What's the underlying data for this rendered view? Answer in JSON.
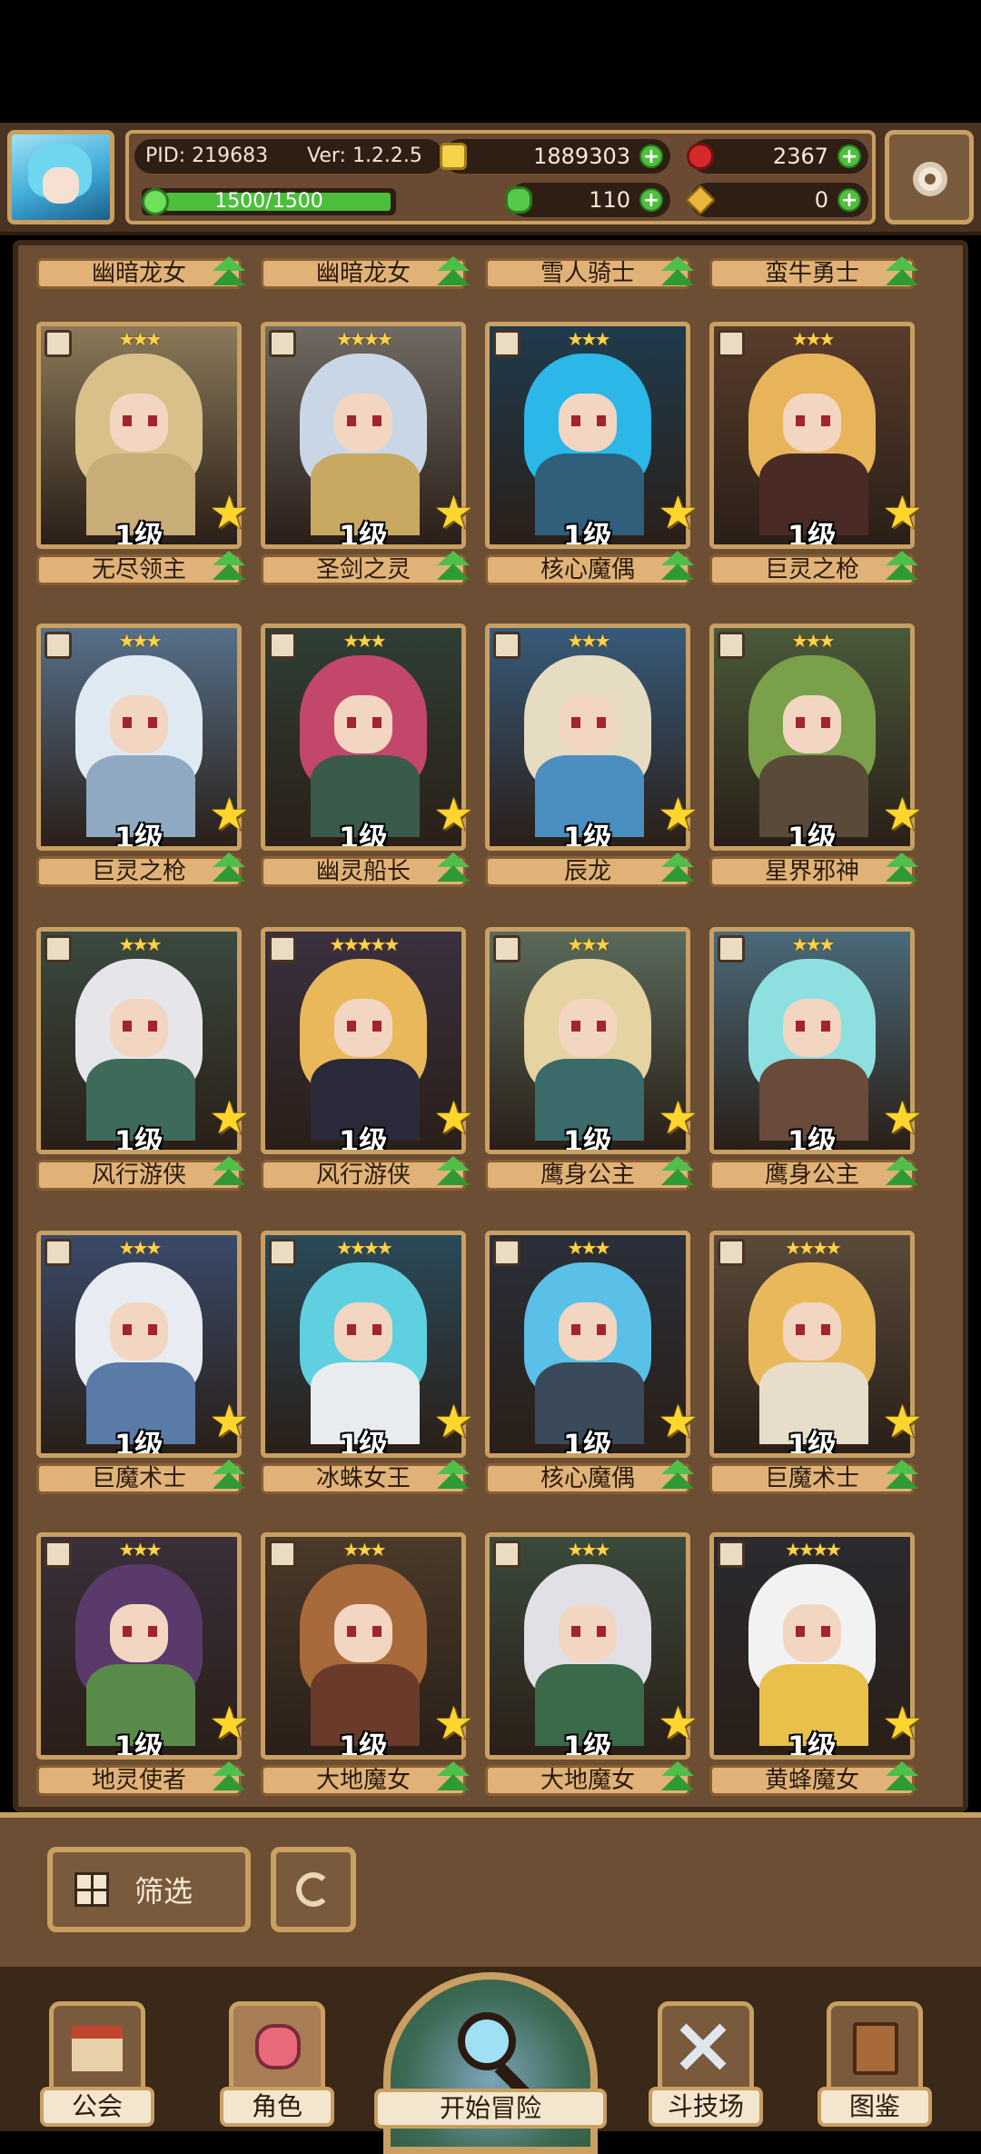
{
  "player": {
    "pid": "PID: 219683",
    "version": "Ver: 1.2.2.5",
    "xp": "1500/1500"
  },
  "currency": {
    "gold": "1889303",
    "gems": "2367",
    "clover": "110",
    "keys": "0"
  },
  "partial_row": [
    "幽暗龙女",
    "幽暗龙女",
    "雪人骑士",
    "蛮牛勇士"
  ],
  "cards": [
    {
      "name": "无尽领主",
      "level": "1级",
      "stars": "★★★",
      "hair": "#d9c08a",
      "body": "#c8ad78",
      "bg": "#8a7a5a"
    },
    {
      "name": "圣剑之灵",
      "level": "1级",
      "stars": "★★★★",
      "hair": "#c9d6e6",
      "body": "#c9a862",
      "bg": "#6f6a62"
    },
    {
      "name": "核心魔偶",
      "level": "1级",
      "stars": "★★★",
      "hair": "#2bb7e8",
      "body": "#2f5f7a",
      "bg": "#1f3b4e"
    },
    {
      "name": "巨灵之枪",
      "level": "1级",
      "stars": "★★★",
      "hair": "#e8b45a",
      "body": "#4a2a24",
      "bg": "#5a3c2c"
    },
    {
      "name": "巨灵之枪",
      "level": "1级",
      "stars": "★★★",
      "hair": "#dfe9f2",
      "body": "#8fa9c2",
      "bg": "#56708a"
    },
    {
      "name": "幽灵船长",
      "level": "1级",
      "stars": "★★★",
      "hair": "#c2476a",
      "body": "#3a5a4a",
      "bg": "#2f3f35"
    },
    {
      "name": "辰龙",
      "level": "1级",
      "stars": "★★★",
      "hair": "#e6dcc2",
      "body": "#4a8fc0",
      "bg": "#375a7a"
    },
    {
      "name": "星界邪神",
      "level": "1级",
      "stars": "★★★",
      "hair": "#7aa04a",
      "body": "#5a4a3a",
      "bg": "#4a5a3a"
    },
    {
      "name": "风行游侠",
      "level": "1级",
      "stars": "★★★",
      "hair": "#e6e6ea",
      "body": "#3e6a5a",
      "bg": "#3a4a40"
    },
    {
      "name": "风行游侠",
      "level": "1级",
      "stars": "★★★★★",
      "hair": "#e8b85a",
      "body": "#2a2a3a",
      "bg": "#3a3040"
    },
    {
      "name": "鹰身公主",
      "level": "1级",
      "stars": "★★★",
      "hair": "#e6d3a2",
      "body": "#3a6a6a",
      "bg": "#5a6a5a"
    },
    {
      "name": "鹰身公主",
      "level": "1级",
      "stars": "★★★",
      "hair": "#8ee0e0",
      "body": "#6a4a3a",
      "bg": "#4a6a7a"
    },
    {
      "name": "巨魔术士",
      "level": "1级",
      "stars": "★★★",
      "hair": "#e8ecf2",
      "body": "#5a7aa8",
      "bg": "#3a4a6a"
    },
    {
      "name": "冰蛛女王",
      "level": "1级",
      "stars": "★★★★",
      "hair": "#5ed0e0",
      "body": "#e8ecef",
      "bg": "#2a4a5a"
    },
    {
      "name": "核心魔偶",
      "level": "1级",
      "stars": "★★★",
      "hair": "#5ac0e8",
      "body": "#3a4a5a",
      "bg": "#2a2f3a"
    },
    {
      "name": "巨魔术士",
      "level": "1级",
      "stars": "★★★★",
      "hair": "#e8b85a",
      "body": "#e8dccb",
      "bg": "#5a4a3a"
    },
    {
      "name": "地灵使者",
      "level": "1级",
      "stars": "★★★",
      "hair": "#5a3a6a",
      "body": "#5a8a4a",
      "bg": "#3a2f3a"
    },
    {
      "name": "大地魔女",
      "level": "1级",
      "stars": "★★★",
      "hair": "#a86a3a",
      "body": "#6a3a2a",
      "bg": "#4a3a2a"
    },
    {
      "name": "大地魔女",
      "level": "1级",
      "stars": "★★★",
      "hair": "#e0e0e6",
      "body": "#3a6a4a",
      "bg": "#3a4a3a"
    },
    {
      "name": "黄蜂魔女",
      "level": "1级",
      "stars": "★★★★",
      "hair": "#f2f2f2",
      "body": "#e8c04a",
      "bg": "#2a2a30"
    }
  ],
  "controls": {
    "filter_label": "筛选"
  },
  "nav": {
    "guild": "公会",
    "character": "角色",
    "adventure": "开始冒险",
    "arena": "斗技场",
    "codex": "图鉴"
  }
}
